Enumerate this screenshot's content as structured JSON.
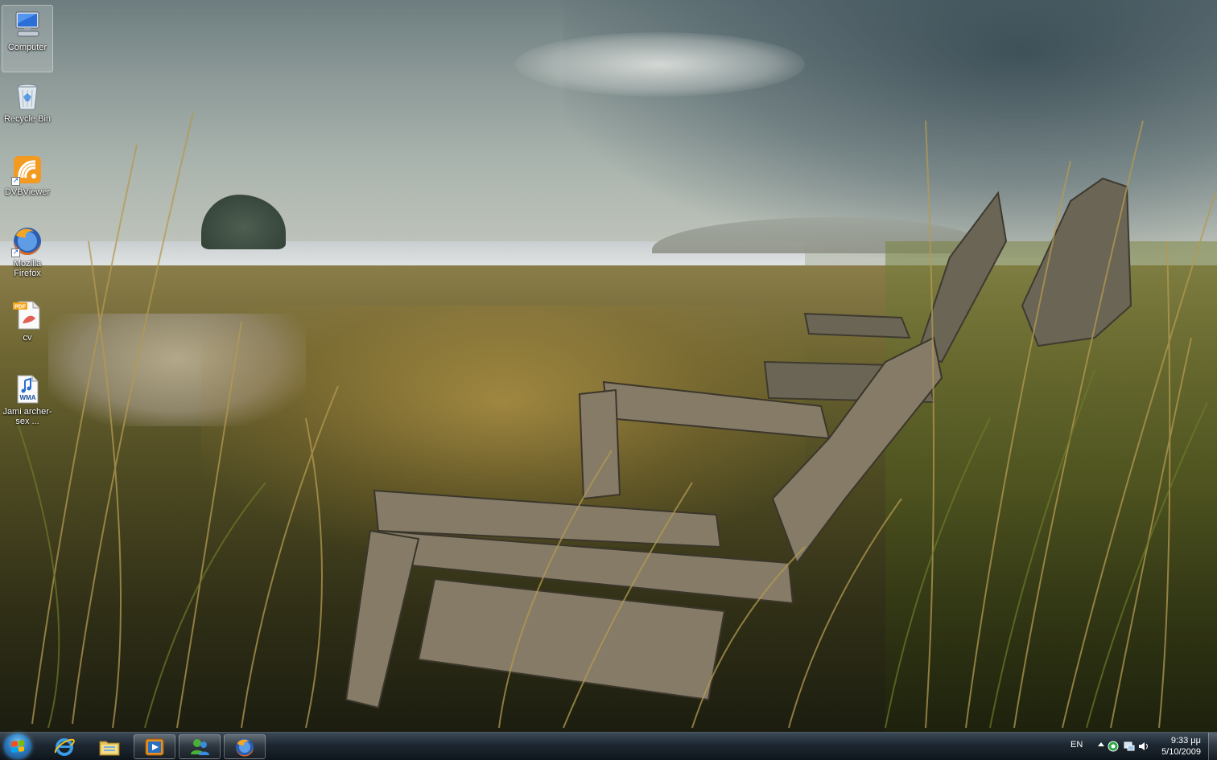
{
  "desktop": {
    "icons": [
      {
        "label": "Computer",
        "icon": "computer-icon",
        "shortcut": false
      },
      {
        "label": "Recycle Bin",
        "icon": "recycle-bin-icon",
        "shortcut": false
      },
      {
        "label": "DVBViewer",
        "icon": "dvbviewer-icon",
        "shortcut": true
      },
      {
        "label": "Mozilla Firefox",
        "icon": "firefox-icon",
        "shortcut": true
      },
      {
        "label": "cv",
        "icon": "pdf-file-icon",
        "badge": "PDF",
        "shortcut": false
      },
      {
        "label": "Jami archer-sex ...",
        "icon": "wma-file-icon",
        "badge": "WMA",
        "shortcut": false
      }
    ]
  },
  "taskbar": {
    "start_button": "start-orb",
    "buttons": [
      {
        "name": "Internet Explorer",
        "icon": "internet-explorer-icon",
        "state": "pinned"
      },
      {
        "name": "Windows Explorer",
        "icon": "folder-icon",
        "state": "pinned"
      },
      {
        "name": "Windows Media Player",
        "icon": "media-player-icon",
        "state": "running"
      },
      {
        "name": "Windows Live Messenger",
        "icon": "messenger-icon",
        "state": "running"
      },
      {
        "name": "Mozilla Firefox",
        "icon": "firefox-icon",
        "state": "running"
      }
    ],
    "tray": {
      "language": "EN",
      "clock_time": "9:33 μμ",
      "clock_date": "5/10/2009"
    }
  },
  "colors": {
    "taskbar": "#1c2630",
    "accent": "#2f7fc4"
  }
}
